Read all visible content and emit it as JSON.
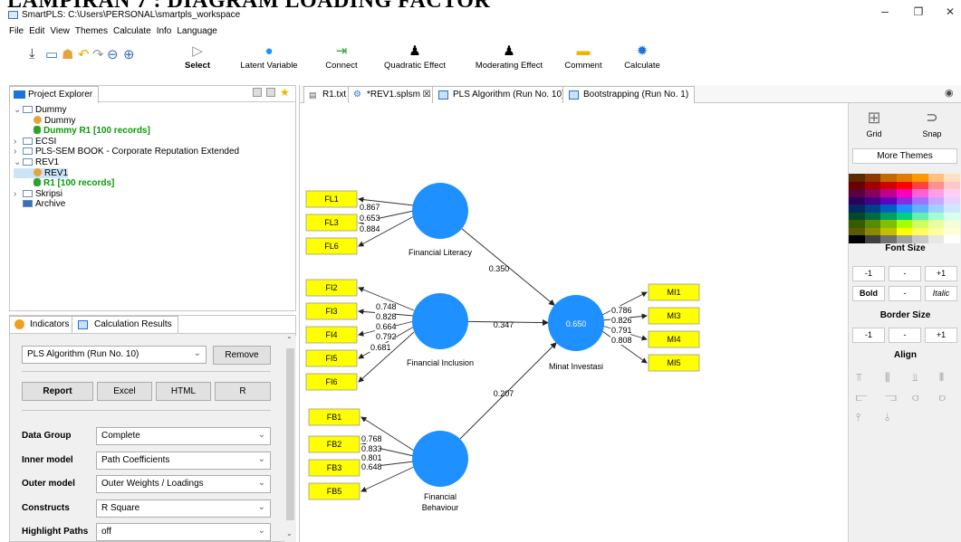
{
  "heading": "LAMPIRAN 7 : DIAGRAM LOADING FACTOR",
  "window": {
    "title": "SmartPLS: C:\\Users\\PERSONAL\\smartpls_workspace",
    "min": "–",
    "max": "❐",
    "close": "✕"
  },
  "menu": [
    "File",
    "Edit",
    "View",
    "Themes",
    "Calculate",
    "Info",
    "Language"
  ],
  "toolbar": {
    "select": "Select",
    "latent": "Latent Variable",
    "connect": "Connect",
    "quadratic": "Quadratic Effect",
    "moderating": "Moderating Effect",
    "comment": "Comment",
    "calculate": "Calculate"
  },
  "project_explorer": {
    "title": "Project Explorer",
    "items": [
      {
        "label": "Dummy",
        "level": 0,
        "type": "folder",
        "open": true
      },
      {
        "label": "Dummy",
        "level": 1,
        "type": "model"
      },
      {
        "label": "Dummy R1 [100 records]",
        "level": 1,
        "type": "data"
      },
      {
        "label": "ECSI",
        "level": 0,
        "type": "folder",
        "open": false
      },
      {
        "label": "PLS-SEM BOOK - Corporate Reputation Extended",
        "level": 0,
        "type": "folder",
        "open": false
      },
      {
        "label": "REV1",
        "level": 0,
        "type": "folder",
        "open": true
      },
      {
        "label": "REV1",
        "level": 1,
        "type": "model",
        "selected": true
      },
      {
        "label": "R1 [100 records]",
        "level": 1,
        "type": "data"
      },
      {
        "label": "Skripsi",
        "level": 0,
        "type": "folder",
        "open": false
      },
      {
        "label": "Archive",
        "level": 0,
        "type": "archive"
      }
    ]
  },
  "lower_tabs": {
    "indicators": "Indicators",
    "calc": "Calculation Results"
  },
  "calc": {
    "run": "PLS Algorithm (Run No. 10)",
    "remove": "Remove",
    "report": "Report",
    "excel": "Excel",
    "html": "HTML",
    "r": "R",
    "rows": [
      {
        "label": "Data Group",
        "value": "Complete"
      },
      {
        "label": "Inner model",
        "value": "Path Coefficients"
      },
      {
        "label": "Outer model",
        "value": "Outer Weights / Loadings"
      },
      {
        "label": "Constructs",
        "value": "R Square"
      },
      {
        "label": "Highlight Paths",
        "value": "off"
      }
    ]
  },
  "editor_tabs": [
    "R1.txt",
    "*REV1.splsm ☒",
    "PLS Algorithm (Run No. 10)",
    "Bootstrapping (Run No. 1)"
  ],
  "diagram": {
    "constructs": {
      "fl": "Financial Literacy",
      "fi": "Financial Inclusion",
      "fb1": "Financial",
      "fb2": "Behaviour",
      "mi": "Minat Investasi",
      "r2": "0.650"
    },
    "indicators": {
      "fl": [
        "FL1",
        "FL3",
        "FL6"
      ],
      "fi": [
        "FI2",
        "FI3",
        "FI4",
        "FI5",
        "FI6"
      ],
      "fb": [
        "FB1",
        "FB2",
        "FB3",
        "FB5"
      ],
      "mi": [
        "MI1",
        "MI3",
        "MI4",
        "MI5"
      ]
    },
    "loadings": {
      "fl": [
        "0.867",
        "0.653",
        "0.884"
      ],
      "fi": [
        "0.748",
        "0.828",
        "0.664",
        "0.792",
        "0.681"
      ],
      "fb": [
        "0.768",
        "0.833",
        "0.801",
        "0.648"
      ],
      "mi": [
        "0.786",
        "0.826",
        "0.791",
        "0.808"
      ]
    },
    "paths": {
      "fl": "0.350",
      "fi": "0.347",
      "fb": "0.207"
    }
  },
  "right_panel": {
    "grid": "Grid",
    "snap": "Snap",
    "more_themes": "More Themes",
    "font_size": "Font Size",
    "minus1": "-1",
    "dash": "-",
    "plus1": "+1",
    "bold": "Bold",
    "italic": "Italic",
    "border_size": "Border Size",
    "align": "Align"
  },
  "colors": {
    "construct": "#1e90ff",
    "indicator": "#ffff00",
    "data_green": "#0a9a0a"
  }
}
